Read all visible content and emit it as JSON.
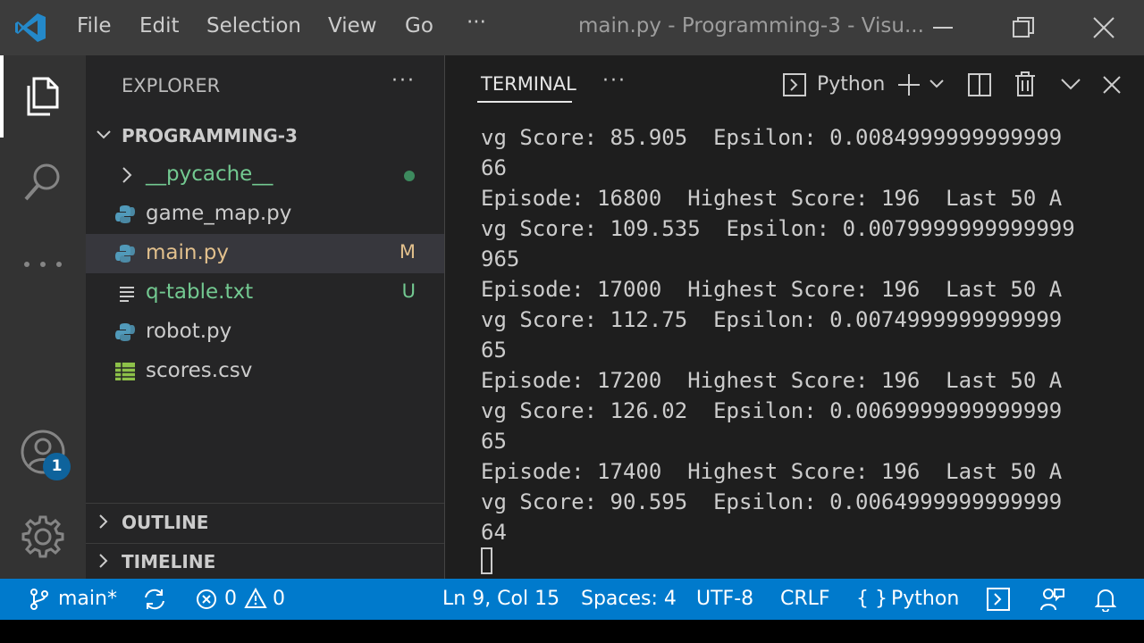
{
  "titlebar": {
    "menu": [
      "File",
      "Edit",
      "Selection",
      "View",
      "Go"
    ],
    "more": "···",
    "window_title": "main.py - Programming-3 - Visu..."
  },
  "activity": {
    "icons": [
      "files-icon",
      "search-icon",
      "more-icon",
      "account-icon",
      "settings-gear-icon"
    ],
    "account_badge": "1"
  },
  "explorer": {
    "title": "EXPLORER",
    "more": "···",
    "folder": "PROGRAMMING-3",
    "files": [
      {
        "name": "__pycache__",
        "status": "",
        "color": "#73c991",
        "kind": "folder"
      },
      {
        "name": "game_map.py",
        "status": "",
        "color": "#cccccc",
        "kind": "python"
      },
      {
        "name": "main.py",
        "status": "M",
        "color": "#e2c08d",
        "kind": "python"
      },
      {
        "name": "q-table.txt",
        "status": "U",
        "color": "#73c991",
        "kind": "text"
      },
      {
        "name": "robot.py",
        "status": "",
        "color": "#cccccc",
        "kind": "python"
      },
      {
        "name": "scores.csv",
        "status": "",
        "color": "#cccccc",
        "kind": "csv"
      }
    ],
    "outline": "OUTLINE",
    "timeline": "TIMELINE"
  },
  "terminal": {
    "tab": "TERMINAL",
    "more": "···",
    "shell": "Python",
    "lines": [
      "vg Score: 85.905  Epsilon: 0.0084999999999999",
      "66",
      "Episode: 16800  Highest Score: 196  Last 50 A",
      "vg Score: 109.535  Epsilon: 0.0079999999999999",
      "965",
      "Episode: 17000  Highest Score: 196  Last 50 A",
      "vg Score: 112.75  Epsilon: 0.0074999999999999",
      "65",
      "Episode: 17200  Highest Score: 196  Last 50 A",
      "vg Score: 126.02  Epsilon: 0.0069999999999999",
      "65",
      "Episode: 17400  Highest Score: 196  Last 50 A",
      "vg Score: 90.595  Epsilon: 0.0064999999999999",
      "64"
    ]
  },
  "statusbar": {
    "branch": "main*",
    "errors": "0",
    "warnings": "0",
    "position": "Ln 9, Col 15",
    "spaces": "Spaces: 4",
    "encoding": "UTF-8",
    "eol": "CRLF",
    "language": "Python",
    "lang_braces": "{ }"
  },
  "colors": {
    "accent": "#007acc",
    "modified": "#e2c08d",
    "untracked": "#73c991",
    "python_blue": "#519aba"
  }
}
